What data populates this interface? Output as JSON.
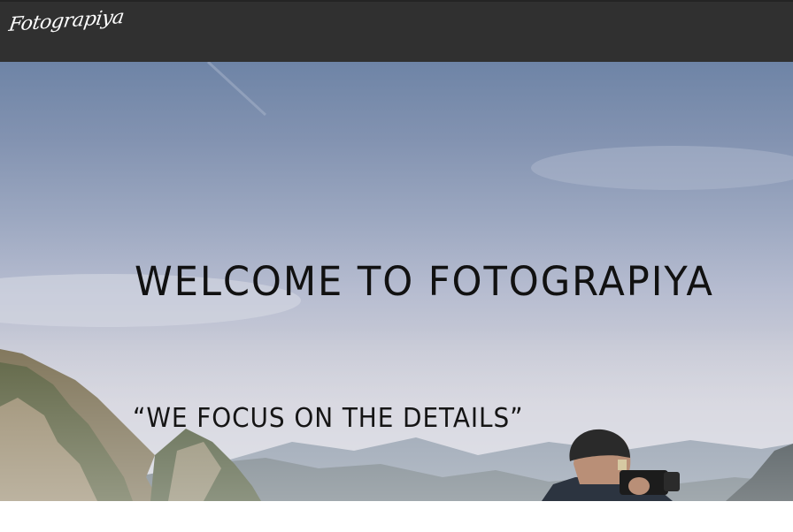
{
  "nav": {
    "logo_text": "Fotograpiya"
  },
  "hero": {
    "title": "WELCOME TO FOTOGRAPIYA",
    "tagline": "“WE FOCUS ON THE DETAILS”"
  },
  "colors": {
    "nav_background": "#303030",
    "nav_text": "#ffffff",
    "hero_text": "#111111"
  }
}
